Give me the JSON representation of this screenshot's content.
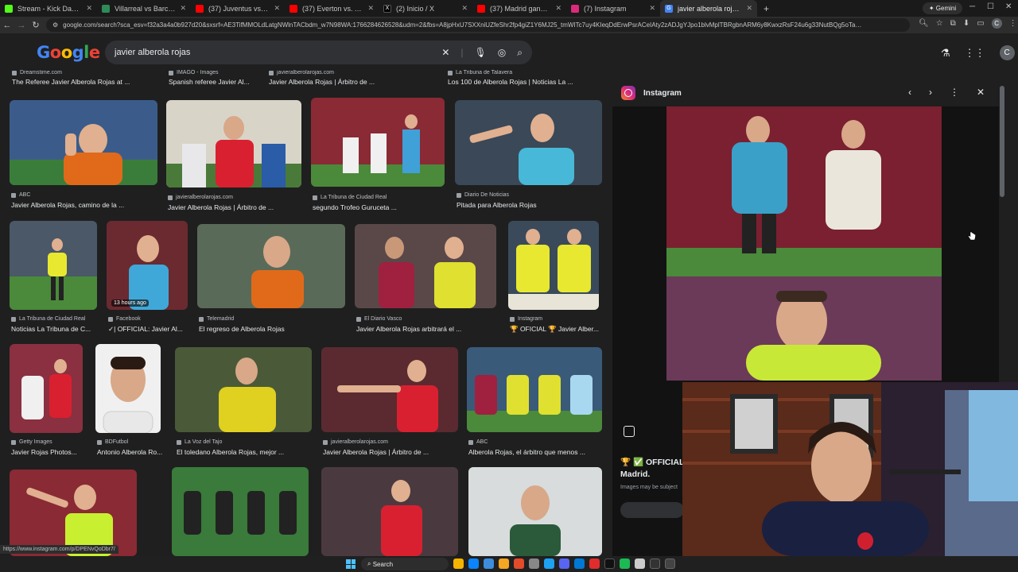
{
  "browser": {
    "tabs": [
      {
        "label": "Stream - Kick Dashboard",
        "color": "#53fc18",
        "active": false
      },
      {
        "label": "Villarreal vs Barcelona - marca...",
        "color": "#2e8b57",
        "active": false
      },
      {
        "label": "(37) Juventus vs. Roma: Extend...",
        "color": "#ff0000",
        "active": false
      },
      {
        "label": "(37) Everton vs. Arsenal | Highl...",
        "color": "#ff0000",
        "active": false
      },
      {
        "label": "(2) Inicio / X",
        "color": "#000000",
        "active": false
      },
      {
        "label": "(37) Madrid gana y Mbappe ig...",
        "color": "#ff0000",
        "active": false
      },
      {
        "label": "(7) Instagram",
        "color": "#dd2a7b",
        "active": false
      },
      {
        "label": "javier alberola rojas - Google S...",
        "color": "#4285f4",
        "active": true
      }
    ],
    "gemini_label": "Gemini",
    "url": "google.com/search?sca_esv=f32a3a4a0b927d20&sxsrf=AE3TifMMOLdLatgNWlnTACbdm_w7N98WA:1766284626528&udm=2&fbs=A8jpHxU7SXXniUZfeShr2fp4giZ1Y6MJ25_tmWITc7uy4KIeqDdErwPsrACeIAty2zADJgYJpo1blvMplTBRgbnARM6y8KwxzRsF24u6g33NutBQg5oTaOPEjth5eaMj6wzNwV6XsSRQAWh3N3C-OcFaIMGEXLKhO...",
    "profile_initial": "C"
  },
  "google": {
    "logo_letters": [
      "G",
      "o",
      "o",
      "g",
      "l",
      "e"
    ],
    "query": "javier alberola rojas",
    "profile_initial": "C"
  },
  "results": {
    "top_row": [
      {
        "source": "Dreamstime.com",
        "caption": "The Referee Javier Alberola Rojas at ..."
      },
      {
        "source": "IMAGO - Images",
        "caption": "Spanish referee Javier Al..."
      },
      {
        "source": "javieralberolarojas.com",
        "caption": "Javier Alberola Rojas | Árbitro de ..."
      },
      {
        "source": "La Tribuna de Talavera",
        "caption": "Los 100 de Alberola Rojas | Noticias La ..."
      }
    ],
    "row1": [
      {
        "source": "ABC",
        "caption": "Javier Alberola Rojas, camino de la ..."
      },
      {
        "source": "javieralberolarojas.com",
        "caption": "Javier Alberola Rojas | Árbitro de ..."
      },
      {
        "source": "La Tribuna de Ciudad Real",
        "caption": "segundo Trofeo Guruceta ..."
      },
      {
        "source": "Diario De Noticias",
        "caption": "Pitada para Alberola Rojas"
      }
    ],
    "row2": [
      {
        "source": "La Tribuna de Ciudad Real",
        "caption": "Noticias La Tribuna de C..."
      },
      {
        "source": "Facebook",
        "caption": "✓| OFFICIAL: Javier Al...",
        "badge": "13 hours ago"
      },
      {
        "source": "Telemadrid",
        "caption": "El regreso de Alberola Rojas"
      },
      {
        "source": "El Diario Vasco",
        "caption": "Javier Alberola Rojas arbitrará el ..."
      },
      {
        "source": "Instagram",
        "caption": "🏆 OFICIAL 🏆 Javier Alber..."
      }
    ],
    "row3": [
      {
        "source": "Getty Images",
        "caption": "Javier Rojas Photos..."
      },
      {
        "source": "BDFutbol",
        "caption": "Antonio Alberola Ro..."
      },
      {
        "source": "La Voz del Tajo",
        "caption": "El toledano Alberola Rojas, mejor ..."
      },
      {
        "source": "javieralberolarojas.com",
        "caption": "Javier Alberola Rojas | Árbitro de ..."
      },
      {
        "source": "ABC",
        "caption": "Alberola Rojas, el árbitro que menos ..."
      }
    ]
  },
  "panel": {
    "site": "Instagram",
    "caption": "🏆 ✅ OFFICIAL Madrid.",
    "note": "Images may be subject"
  },
  "status_url": "https://www.instagram.com/p/DPENvQoDbr7/",
  "taskbar": {
    "search_label": "Search",
    "apps": [
      "#f4b400",
      "#0a84ff",
      "#3c8dde",
      "#f5a623",
      "#e34b2a",
      "#888888",
      "#1da1f2",
      "#5865f2",
      "#0078d4",
      "#e02c2c",
      "#111111",
      "#1db954",
      "#cccccc",
      "#333333",
      "#444444"
    ]
  }
}
